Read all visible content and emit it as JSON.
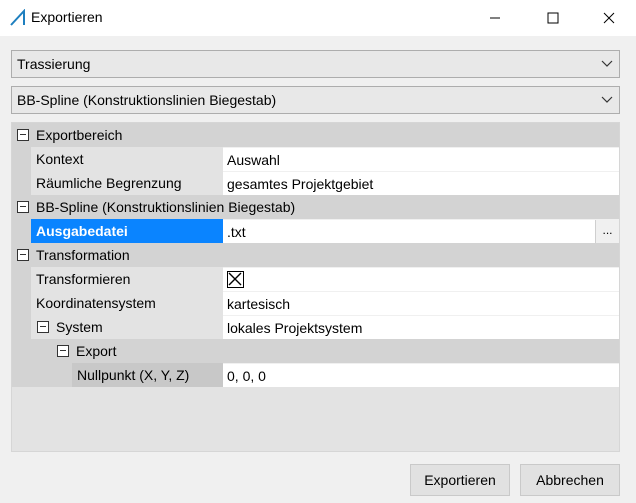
{
  "window": {
    "title": "Exportieren",
    "icon": "triangle-ruler-icon",
    "controls": [
      "minimize-icon",
      "maximize-icon",
      "close-icon"
    ]
  },
  "combos": {
    "format": "Trassierung",
    "type": "BB-Spline (Konstruktionslinien Biegestab)"
  },
  "grid": {
    "cat_exportbereich": "Exportbereich",
    "kontext_label": "Kontext",
    "kontext_value": "Auswahl",
    "begrenzung_label": "Räumliche Begrenzung",
    "begrenzung_value": "gesamtes Projektgebiet",
    "cat_bbspline": "BB-Spline (Konstruktionslinien Biegestab)",
    "ausgabedatei_label": "Ausgabedatei",
    "ausgabedatei_value": ".txt",
    "browse_label": "...",
    "cat_transformation": "Transformation",
    "transformieren_label": "Transformieren",
    "transformieren_checked": true,
    "koordsys_label": "Koordinatensystem",
    "koordsys_value": "kartesisch",
    "system_label": "System",
    "system_value": "lokales Projektsystem",
    "export_label": "Export",
    "nullpunkt_label": "Nullpunkt (X, Y, Z)",
    "nullpunkt_value": "0, 0, 0"
  },
  "buttons": {
    "export": "Exportieren",
    "cancel": "Abbrechen"
  },
  "colors": {
    "selection": "#0a84ff",
    "category_bg": "#d3d3d3",
    "accent_icon": "#1e7fbf"
  }
}
